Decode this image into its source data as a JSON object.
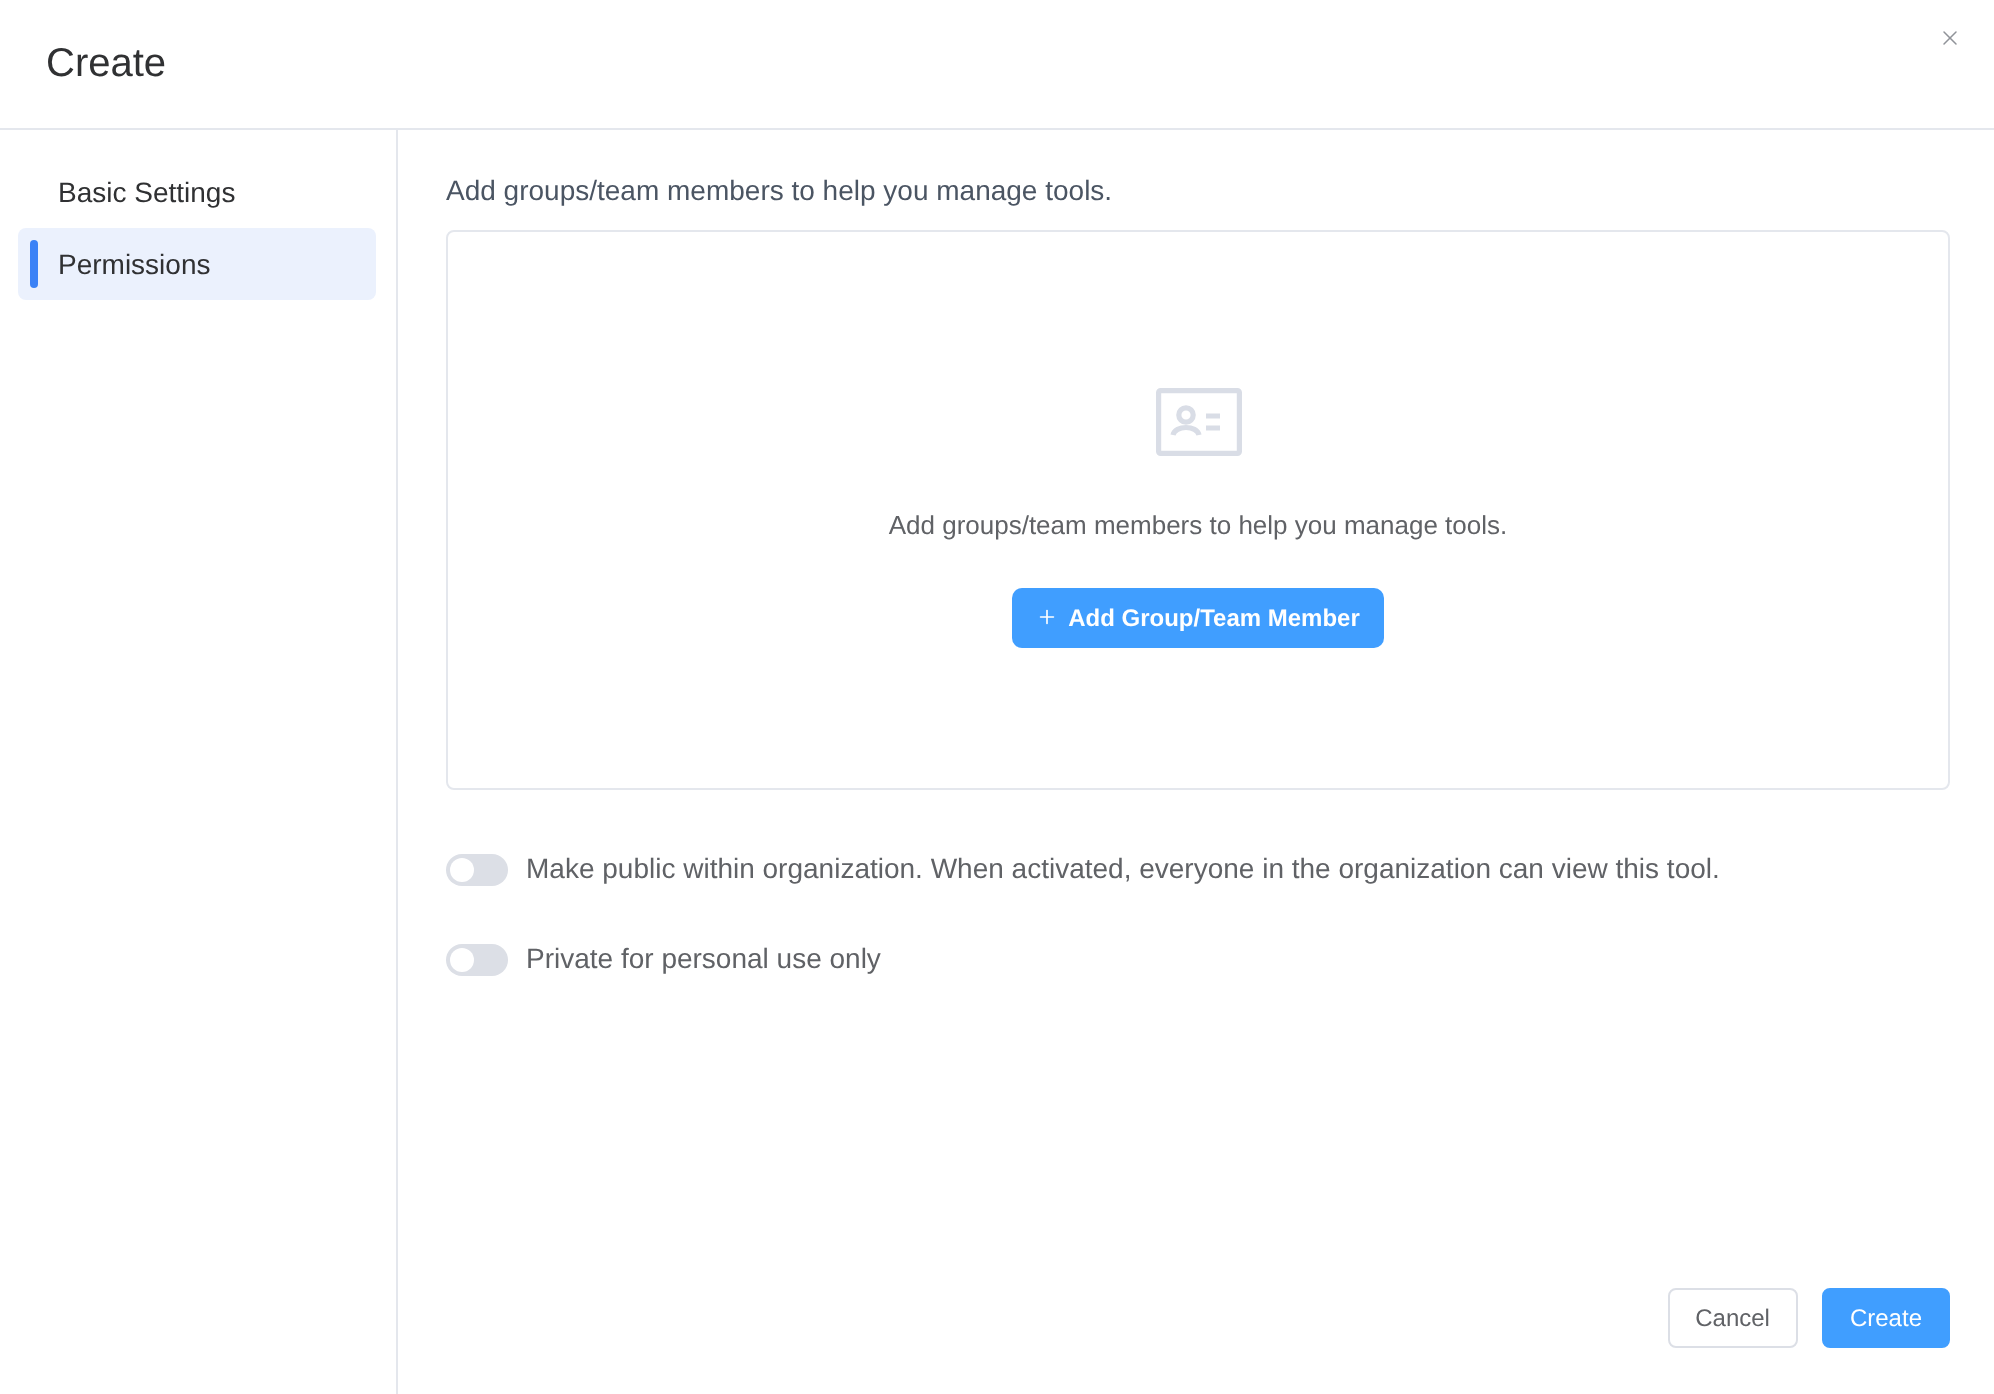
{
  "dialog": {
    "title": "Create"
  },
  "sidebar": {
    "items": [
      {
        "label": "Basic Settings",
        "selected": false
      },
      {
        "label": "Permissions",
        "selected": true
      }
    ]
  },
  "permissions": {
    "description": "Add groups/team members to help you manage tools.",
    "empty_state": {
      "message": "Add groups/team members to help you manage tools.",
      "button": "Add Group/Team Member"
    },
    "toggles": [
      {
        "label": "Make public within organization. When activated, everyone in the organization can view this tool.",
        "on": false
      },
      {
        "label": "Private for personal use only",
        "on": false
      }
    ]
  },
  "footer": {
    "buttons": [
      {
        "label": "Cancel",
        "kind": "secondary"
      },
      {
        "label": "Create",
        "kind": "primary"
      }
    ]
  }
}
